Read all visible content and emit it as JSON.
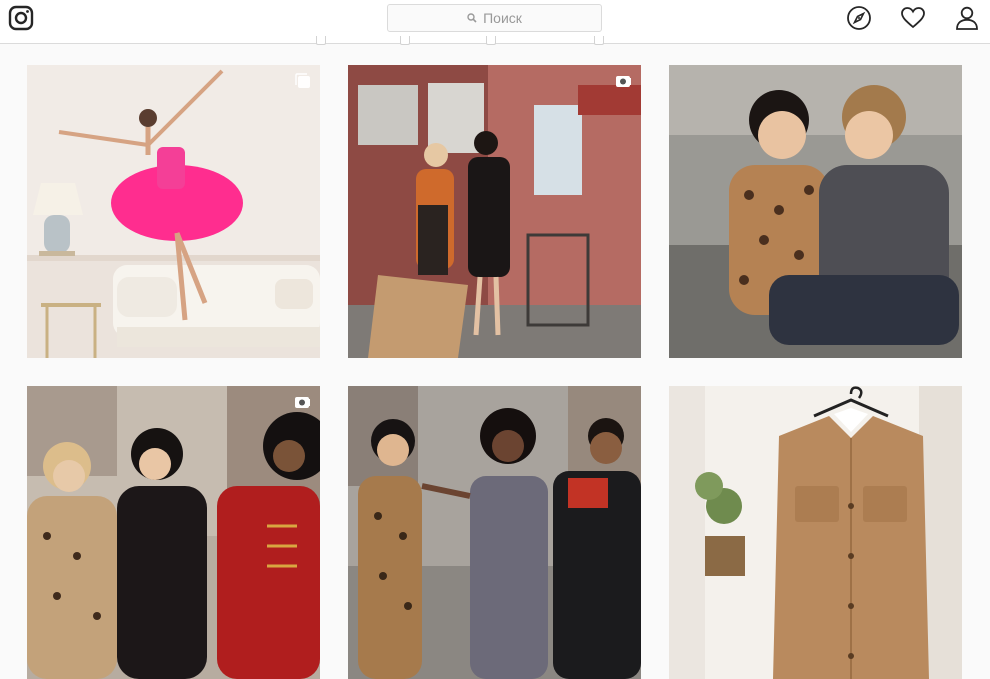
{
  "header": {
    "search": {
      "placeholder": "Поиск"
    },
    "icons": [
      "instagram-logo-icon",
      "search-icon",
      "compass-icon",
      "heart-icon",
      "user-icon"
    ]
  },
  "posts": [
    {
      "badge": "multiple-posts-icon",
      "subject": "dancer-pink-tutu"
    },
    {
      "badge": "igtv-icon",
      "subject": "street-two-friends"
    },
    {
      "badge": "",
      "subject": "two-women-leopard"
    },
    {
      "badge": "igtv-icon",
      "subject": "three-women-street"
    },
    {
      "badge": "",
      "subject": "group-dancing-street"
    },
    {
      "badge": "",
      "subject": "camel-jacket-hanger"
    }
  ],
  "colors": {
    "header_bg": "#ffffff",
    "page_bg": "#fafafa",
    "border": "#dbdbdb",
    "placeholder_text": "#999999",
    "icon": "#262626"
  }
}
